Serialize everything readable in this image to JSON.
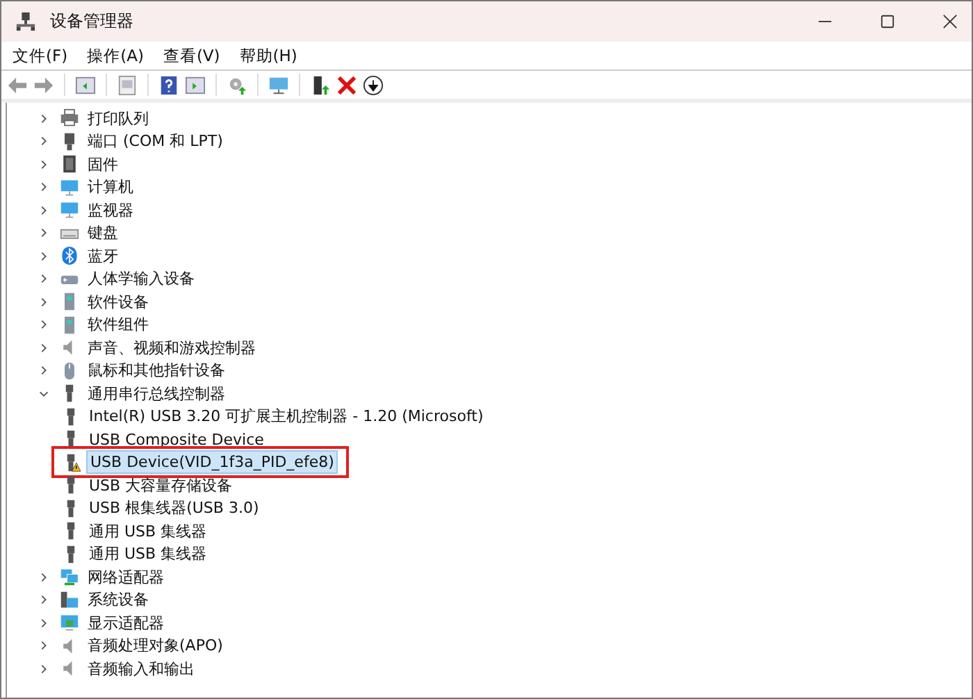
{
  "window": {
    "title": "设备管理器"
  },
  "menu": [
    "文件(F)",
    "操作(A)",
    "查看(V)",
    "帮助(H)"
  ],
  "tree": [
    {
      "label": "打印队列",
      "expanded": false,
      "selected": false
    },
    {
      "label": "端口 (COM 和 LPT)",
      "expanded": false,
      "selected": false
    },
    {
      "label": "固件",
      "expanded": false,
      "selected": false
    },
    {
      "label": "计算机",
      "expanded": false,
      "selected": false
    },
    {
      "label": "监视器",
      "expanded": false,
      "selected": false
    },
    {
      "label": "键盘",
      "expanded": false,
      "selected": false
    },
    {
      "label": "蓝牙",
      "expanded": false,
      "selected": false
    },
    {
      "label": "人体学输入设备",
      "expanded": false,
      "selected": false
    },
    {
      "label": "软件设备",
      "expanded": false,
      "selected": false
    },
    {
      "label": "软件组件",
      "expanded": false,
      "selected": false
    },
    {
      "label": "声音、视频和游戏控制器",
      "expanded": false,
      "selected": false
    },
    {
      "label": "鼠标和其他指针设备",
      "expanded": false,
      "selected": false
    },
    {
      "label": "通用串行总线控制器",
      "expanded": true,
      "selected": false,
      "children": [
        {
          "label": "Intel(R) USB 3.20 可扩展主机控制器 - 1.20 (Microsoft)",
          "selected": false,
          "warning": false,
          "highlighted": false
        },
        {
          "label": "USB Composite Device",
          "selected": false,
          "warning": false,
          "highlighted": false
        },
        {
          "label": "USB Device(VID_1f3a_PID_efe8)",
          "selected": true,
          "warning": true,
          "highlighted": true
        },
        {
          "label": "USB 大容量存储设备",
          "selected": false,
          "warning": false,
          "highlighted": false
        },
        {
          "label": "USB 根集线器(USB 3.0)",
          "selected": false,
          "warning": false,
          "highlighted": false
        },
        {
          "label": "通用 USB 集线器",
          "selected": false,
          "warning": false,
          "highlighted": false
        },
        {
          "label": "通用 USB 集线器",
          "selected": false,
          "warning": false,
          "highlighted": false
        }
      ]
    },
    {
      "label": "网络适配器",
      "expanded": false,
      "selected": false
    },
    {
      "label": "系统设备",
      "expanded": false,
      "selected": false
    },
    {
      "label": "显示适配器",
      "expanded": false,
      "selected": false
    },
    {
      "label": "音频处理对象(APO)",
      "expanded": false,
      "selected": false
    },
    {
      "label": "音频输入和输出",
      "expanded": false,
      "selected": false
    }
  ]
}
